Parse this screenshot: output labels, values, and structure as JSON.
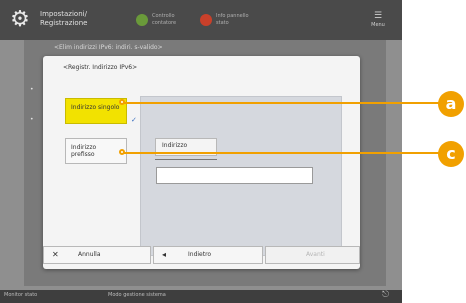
{
  "header": {
    "title": "Impostazioni/ Registrazione",
    "btn1": "Controllo contatore",
    "btn2": "Info pannello stato",
    "menu": "Menu"
  },
  "background": {
    "breadcrumb": "<Elim indirizzi IPv6: indiri. s-valido>",
    "bullets": [
      "•",
      "•"
    ]
  },
  "dialog": {
    "title": "<Registr. Indirizzo IPv6>",
    "single_btn": "Indirizzo singolo",
    "prefix_btn": "Indirizzo prefisso",
    "address_label": "Indirizzo",
    "address_value": "",
    "marker": "✓",
    "footer": {
      "cancel": "Annulla",
      "back": "Indietro",
      "next": "Avanti"
    }
  },
  "statusbar": {
    "monitor": "Monitor stato",
    "system": "Modo gestione sistema"
  },
  "callouts": [
    {
      "label": "a"
    },
    {
      "label": "c"
    }
  ],
  "colors": {
    "accent": "#f1a000",
    "selected": "#f2e200"
  }
}
